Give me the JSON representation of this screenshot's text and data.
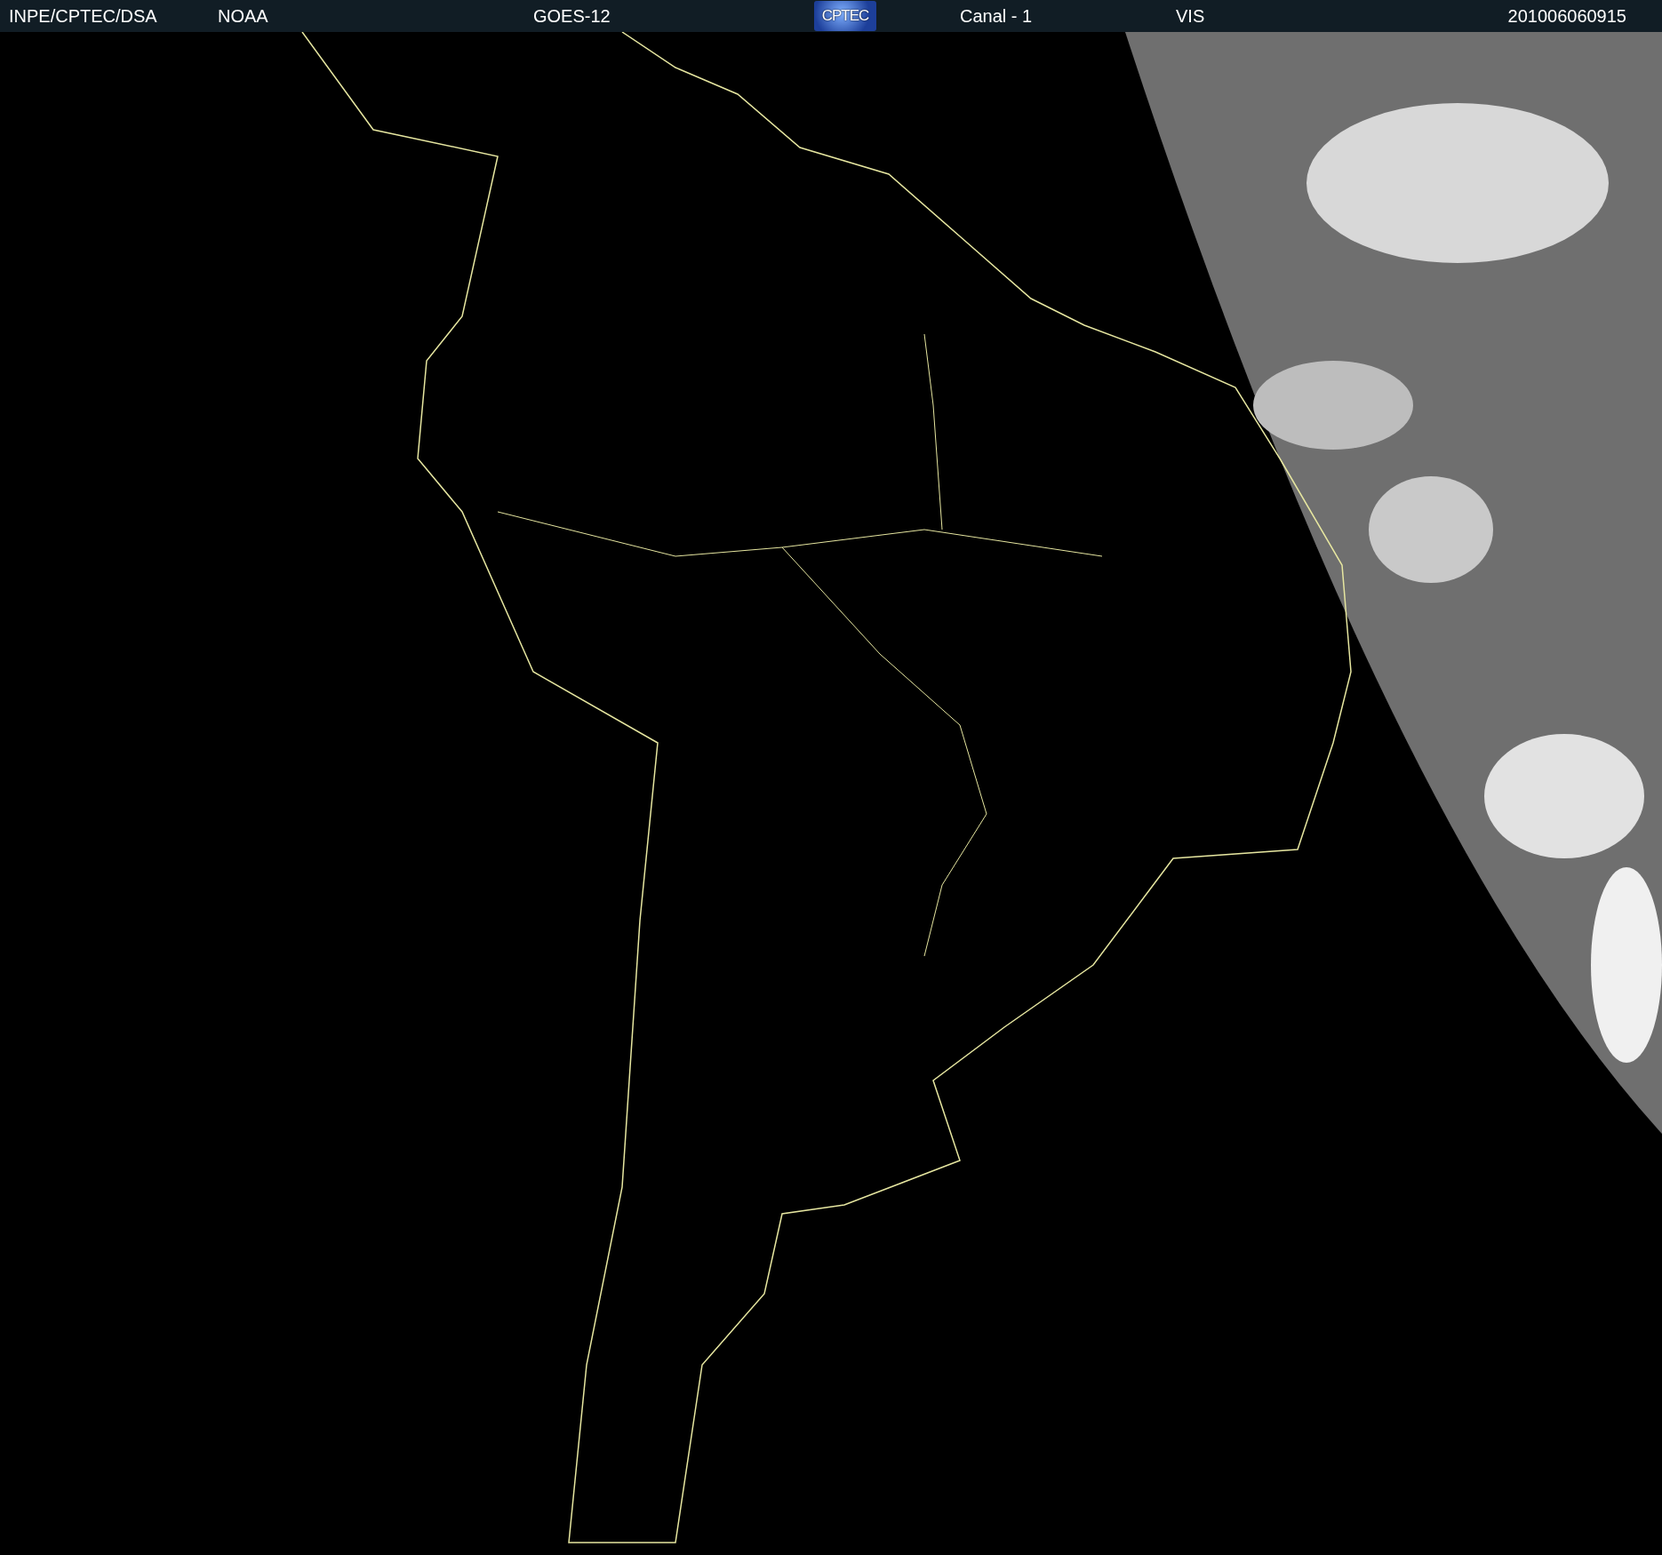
{
  "header": {
    "items": [
      {
        "kind": "text",
        "text": "INPE/CPTEC/DSA"
      },
      {
        "kind": "text",
        "text": "NOAA"
      },
      {
        "kind": "text",
        "text": "GOES-12"
      },
      {
        "kind": "logo",
        "text": "CPTEC"
      },
      {
        "kind": "text",
        "text": "Canal - 1"
      },
      {
        "kind": "text",
        "text": "VIS"
      },
      {
        "kind": "text",
        "text": "201006060915"
      }
    ]
  }
}
